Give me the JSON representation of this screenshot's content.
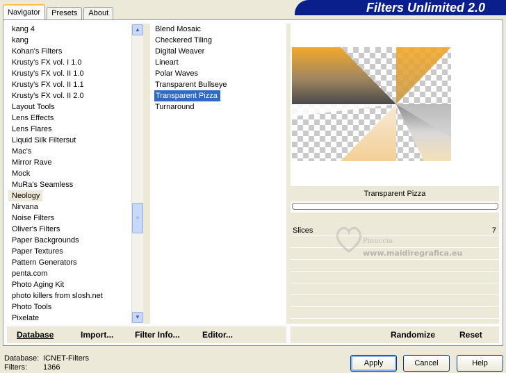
{
  "tabs": [
    {
      "label": "Navigator",
      "active": true
    },
    {
      "label": "Presets",
      "active": false
    },
    {
      "label": "About",
      "active": false
    }
  ],
  "banner": {
    "title": "Filters Unlimited 2.0"
  },
  "categories": {
    "items": [
      "kang 4",
      "kang",
      "Kohan's Filters",
      "Krusty's FX vol. I 1.0",
      "Krusty's FX vol. II 1.0",
      "Krusty's FX vol. II 1.1",
      "Krusty's FX vol. II 2.0",
      "Layout Tools",
      "Lens Effects",
      "Lens Flares",
      "Liquid Silk Filtersut",
      "Mac's",
      "Mirror Rave",
      "Mock",
      "MuRa's Seamless",
      "Neology",
      "Nirvana",
      "Noise Filters",
      "Oliver's Filters",
      "Paper Backgrounds",
      "Paper Textures",
      "Pattern Generators",
      "penta.com",
      "Photo Aging Kit",
      "photo killers from slosh.net",
      "Photo Tools",
      "Pixelate"
    ],
    "selected": "Neology"
  },
  "filters": {
    "items": [
      "Blend Mosaic",
      "Checkered Tiling",
      "Digital Weaver",
      "Lineart",
      "Polar Waves",
      "Transparent Bullseye",
      "Transparent Pizza",
      "Turnaround"
    ],
    "selected": "Transparent Pizza"
  },
  "preview": {
    "filter_name": "Transparent Pizza"
  },
  "params": [
    {
      "name": "Slices",
      "value": "7"
    }
  ],
  "watermark": {
    "line1": "Pinuccia",
    "line2": "www.maidiregrafica.eu"
  },
  "left_links": {
    "database": "Database",
    "import": "Import...",
    "filter_info": "Filter Info...",
    "editor": "Editor..."
  },
  "right_links": {
    "randomize": "Randomize",
    "reset": "Reset"
  },
  "status": {
    "database_label": "Database:",
    "database_value": "ICNET-Filters",
    "filters_label": "Filters:",
    "filters_value": "1366"
  },
  "buttons": {
    "apply": "Apply",
    "cancel": "Cancel",
    "help": "Help"
  },
  "colors": {
    "selection": "#316ac5",
    "banner": "#0a1e8c",
    "face": "#ece9d8"
  }
}
